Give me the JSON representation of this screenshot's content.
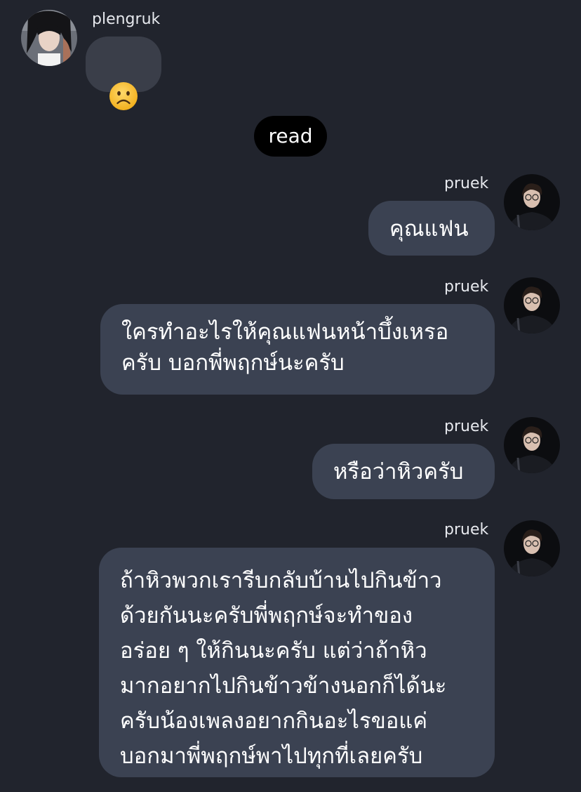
{
  "messages": [
    {
      "sender": "plengruk",
      "side": "left",
      "emoji": "frowning-face-emoji"
    },
    {
      "system": "read"
    },
    {
      "sender": "pruek",
      "side": "right",
      "text": "คุณแฟน"
    },
    {
      "sender": "pruek",
      "side": "right",
      "text": "ใครทำอะไรให้คุณแฟนหน้าบึ้งเหรอ\nครับ บอกพี่พฤกษ์นะครับ"
    },
    {
      "sender": "pruek",
      "side": "right",
      "text": "หรือว่าหิวครับ"
    },
    {
      "sender": "pruek",
      "side": "right",
      "text": "ถ้าหิวพวกเรารีบกลับบ้านไปกินข้าว\nด้วยกันนะครับพี่พฤกษ์จะทำของ\nอร่อย ๆ ให้กินนะครับ แต่ว่าถ้าหิว\nมากอยากไปกินข้าวข้างนอกก็ได้นะ\nครับน้องเพลงอยากกินอะไรขอแค่\nบอกมาพี่พฤกษ์พาไปทุกที่เลยครับ"
    }
  ],
  "colors": {
    "background": "#21242d",
    "bubble_right": "#3b4252",
    "bubble_left": "#3a3e49",
    "read_pill": "#000000"
  }
}
